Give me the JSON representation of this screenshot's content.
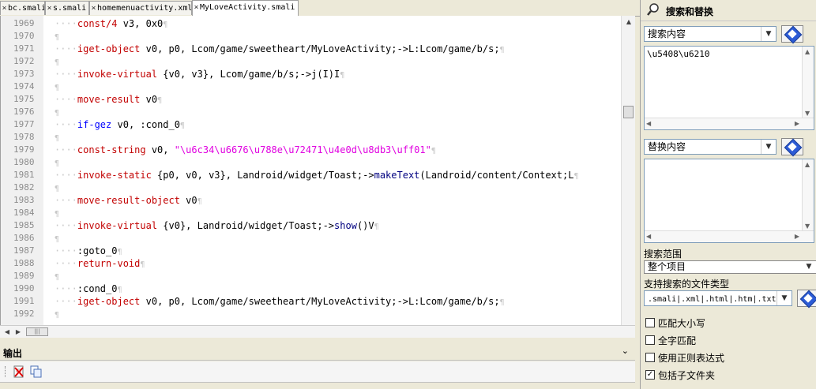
{
  "tabs": [
    {
      "label": "bc.smali",
      "active": false
    },
    {
      "label": "s.smali",
      "active": false
    },
    {
      "label": "homemenuactivity.xml",
      "active": false
    },
    {
      "label": "MyLoveActivity.smali",
      "active": true
    }
  ],
  "tab_close_glyph": "×",
  "editor": {
    "pilcrow": "¶",
    "lines": [
      {
        "num": "1969",
        "parts": [
          [
            "op",
            "const/4"
          ],
          [
            "blk",
            " v3, 0x0"
          ]
        ]
      },
      {
        "num": "1970",
        "parts": []
      },
      {
        "num": "1971",
        "parts": [
          [
            "op",
            "iget-object"
          ],
          [
            "blk",
            " v0, p0, Lcom/game/sweetheart/MyLoveActivity;->L:Lcom/game/b/s;"
          ]
        ]
      },
      {
        "num": "1972",
        "parts": []
      },
      {
        "num": "1973",
        "parts": [
          [
            "op",
            "invoke-virtual"
          ],
          [
            "blk",
            " {v0, v3}, Lcom/game/b/s;->j(I)I"
          ]
        ]
      },
      {
        "num": "1974",
        "parts": []
      },
      {
        "num": "1975",
        "parts": [
          [
            "op",
            "move-result"
          ],
          [
            "blk",
            " v0"
          ]
        ]
      },
      {
        "num": "1976",
        "parts": []
      },
      {
        "num": "1977",
        "parts": [
          [
            "kw",
            "if-gez"
          ],
          [
            "blk",
            " v0, :cond_0"
          ]
        ]
      },
      {
        "num": "1978",
        "parts": []
      },
      {
        "num": "1979",
        "parts": [
          [
            "op",
            "const-string"
          ],
          [
            "blk",
            " v0, "
          ],
          [
            "str",
            "\"\\u6c34\\u6676\\u788e\\u72471\\u4e0d\\u8db3\\uff01\""
          ]
        ]
      },
      {
        "num": "1980",
        "parts": []
      },
      {
        "num": "1981",
        "parts": [
          [
            "op",
            "invoke-static"
          ],
          [
            "blk",
            " {p0, v0, v3}, Landroid/widget/Toast;->"
          ],
          [
            "nav",
            "makeText"
          ],
          [
            "blk",
            "(Landroid/content/Context;L"
          ]
        ]
      },
      {
        "num": "1982",
        "parts": []
      },
      {
        "num": "1983",
        "parts": [
          [
            "op",
            "move-result-object"
          ],
          [
            "blk",
            " v0"
          ]
        ]
      },
      {
        "num": "1984",
        "parts": []
      },
      {
        "num": "1985",
        "parts": [
          [
            "op",
            "invoke-virtual"
          ],
          [
            "blk",
            " {v0}, Landroid/widget/Toast;->"
          ],
          [
            "nav",
            "show"
          ],
          [
            "blk",
            "()V"
          ]
        ]
      },
      {
        "num": "1986",
        "parts": []
      },
      {
        "num": "1987",
        "parts": [
          [
            "blk",
            ":goto_0"
          ]
        ]
      },
      {
        "num": "1988",
        "parts": [
          [
            "op",
            "return-void"
          ]
        ]
      },
      {
        "num": "1989",
        "parts": []
      },
      {
        "num": "1990",
        "parts": [
          [
            "blk",
            ":cond_0"
          ]
        ]
      },
      {
        "num": "1991",
        "parts": [
          [
            "op",
            "iget-object"
          ],
          [
            "blk",
            " v0, p0, Lcom/game/sweetheart/MyLoveActivity;->L:Lcom/game/b/s;"
          ]
        ]
      },
      {
        "num": "1992",
        "parts": []
      }
    ]
  },
  "output_panel": {
    "title": "输出",
    "collapse_glyph": "⌄"
  },
  "search_panel": {
    "title": "搜索和替换",
    "search_combo": "搜索内容",
    "search_text": "\\u5408\\u6210",
    "replace_combo": "替换内容",
    "replace_text": "",
    "scope_label": "搜索范围",
    "scope_value": "整个项目",
    "filetypes_label": "支持搜索的文件类型",
    "filetypes_value": ".smali|.xml|.html|.htm|.txt",
    "options": [
      {
        "label": "匹配大小写",
        "checked": false
      },
      {
        "label": "全字匹配",
        "checked": false
      },
      {
        "label": "使用正则表达式",
        "checked": false
      },
      {
        "label": "包括子文件夹",
        "checked": true
      }
    ]
  }
}
